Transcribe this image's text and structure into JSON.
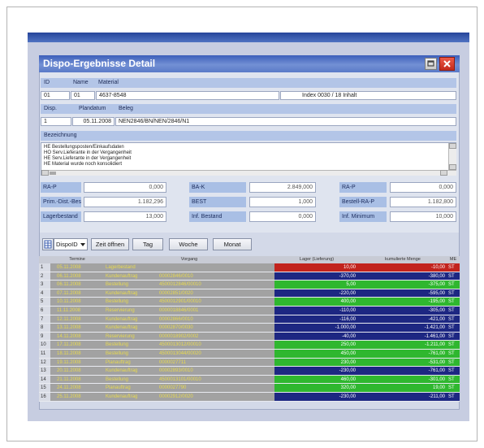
{
  "window": {
    "title": "Dispo-Ergebnisse Detail"
  },
  "header1": {
    "id_label": "ID",
    "name_label": "Name",
    "material_label": "Material"
  },
  "record1": {
    "id": "01",
    "name": "01",
    "material": "4637-8548",
    "index": "Index 0030 / 18 Inhalt"
  },
  "header2": {
    "disp_label": "Disp.",
    "plandatum_label": "Plandatum",
    "beleg_label": "Beleg"
  },
  "record2": {
    "disp": "1",
    "plandatum": "05.11.2008",
    "beleg": "NEN2846/BN/NEN/2846/N1"
  },
  "bezeichnung": {
    "label": "Bezeichnung",
    "lines": [
      "HE Bestellungsposten/Einkaufsdaten",
      "HO Serv.Lieferante in der Vergangenheit",
      "HE Serv.Lieferante in der Vergangenheit",
      "HE Material wurde noch konsolidiert"
    ]
  },
  "fields": {
    "left": [
      {
        "label": "RA-P",
        "value": "0,000"
      },
      {
        "label": "Prim.-Dist.-Best",
        "value": "1.182,296"
      },
      {
        "label": "Lagerbestand",
        "value": "13,000"
      }
    ],
    "middle": [
      {
        "label": "BA-K",
        "value": "2.849,000"
      },
      {
        "label": "BEST",
        "value": "1,000"
      },
      {
        "label": "Inf. Bestand",
        "value": "0,000"
      }
    ],
    "right": [
      {
        "label": "RA-P",
        "value": "0,000"
      },
      {
        "label": "Bestell-RA-P",
        "value": "1.182,800"
      },
      {
        "label": "Inf. Minimum",
        "value": "10,000"
      }
    ]
  },
  "toolbar": {
    "dropdown_value": "DispoID",
    "zeit_label": "Zeit öffnen",
    "tag_label": "Tag",
    "woche_label": "Woche",
    "monat_label": "Monat"
  },
  "table": {
    "columns": {
      "termine": "Termine",
      "vorgang": "Vorgang",
      "lager": "Lager (Lieferung)",
      "kumuliert": "kumulierte Menge",
      "me": "ME"
    },
    "rows": [
      {
        "num": "1",
        "date": "05.11.2008",
        "type": "Lagerbestand",
        "ref": "",
        "lager": "10,00",
        "kum": "-10,00",
        "me": "ST",
        "status": "red"
      },
      {
        "num": "2",
        "date": "06.11.2008",
        "type": "Kundenauftrag",
        "ref": "00002846/0010",
        "lager": "-370,00",
        "kum": "-380,00",
        "me": "ST",
        "status": "navy"
      },
      {
        "num": "3",
        "date": "06.11.2008",
        "type": "Bestellung",
        "ref": "4500012846/00010",
        "lager": "5,00",
        "kum": "-375,00",
        "me": "ST",
        "status": "green"
      },
      {
        "num": "4",
        "date": "07.11.2008",
        "type": "Kundenauftrag",
        "ref": "00002851/0020",
        "lager": "-220,00",
        "kum": "-595,00",
        "me": "ST",
        "status": "navy"
      },
      {
        "num": "5",
        "date": "10.11.2008",
        "type": "Bestellung",
        "ref": "4500012901/00010",
        "lager": "400,00",
        "kum": "-195,00",
        "me": "ST",
        "status": "green"
      },
      {
        "num": "6",
        "date": "11.11.2008",
        "type": "Reservierung",
        "ref": "0000018846/0001",
        "lager": "-110,00",
        "kum": "-305,00",
        "me": "ST",
        "status": "navy"
      },
      {
        "num": "7",
        "date": "12.11.2008",
        "type": "Kundenauftrag",
        "ref": "00002866/0010",
        "lager": "-116,00",
        "kum": "-421,00",
        "me": "ST",
        "status": "navy"
      },
      {
        "num": "8",
        "date": "13.11.2008",
        "type": "Kundenauftrag",
        "ref": "00002870/0030",
        "lager": "-1.000,00",
        "kum": "-1.421,00",
        "me": "ST",
        "status": "navy"
      },
      {
        "num": "9",
        "date": "14.11.2008",
        "type": "Reservierung",
        "ref": "0000018902/0002",
        "lager": "-40,00",
        "kum": "-1.461,00",
        "me": "ST",
        "status": "navy"
      },
      {
        "num": "10",
        "date": "17.11.2008",
        "type": "Bestellung",
        "ref": "4500013012/00010",
        "lager": "250,00",
        "kum": "-1.211,00",
        "me": "ST",
        "status": "green"
      },
      {
        "num": "11",
        "date": "18.11.2008",
        "type": "Bestellung",
        "ref": "4500013044/00020",
        "lager": "450,00",
        "kum": "-761,00",
        "me": "ST",
        "status": "green"
      },
      {
        "num": "12",
        "date": "19.11.2008",
        "type": "Planauftrag",
        "ref": "0000027711",
        "lager": "230,00",
        "kum": "-531,00",
        "me": "ST",
        "status": "green"
      },
      {
        "num": "13",
        "date": "20.11.2008",
        "type": "Kundenauftrag",
        "ref": "00002893/0010",
        "lager": "-230,00",
        "kum": "-761,00",
        "me": "ST",
        "status": "navy"
      },
      {
        "num": "14",
        "date": "21.11.2008",
        "type": "Bestellung",
        "ref": "4500013101/00010",
        "lager": "460,00",
        "kum": "-301,00",
        "me": "ST",
        "status": "green"
      },
      {
        "num": "15",
        "date": "24.11.2008",
        "type": "Planauftrag",
        "ref": "0000027790",
        "lager": "320,00",
        "kum": "19,00",
        "me": "ST",
        "status": "green"
      },
      {
        "num": "16",
        "date": "25.11.2008",
        "type": "Kundenauftrag",
        "ref": "00002912/0020",
        "lager": "-230,00",
        "kum": "-211,00",
        "me": "ST",
        "status": "navy"
      }
    ]
  },
  "colors": {
    "title_bar": "#4a6bc0",
    "status": {
      "red": "#c2231d",
      "navy": "#1d2782",
      "green": "#2fb72f"
    }
  },
  "icons": {
    "restore": "restore-icon",
    "close": "close-icon",
    "toolbar": "grid-icon",
    "dropdown": "chevron-down-icon"
  }
}
